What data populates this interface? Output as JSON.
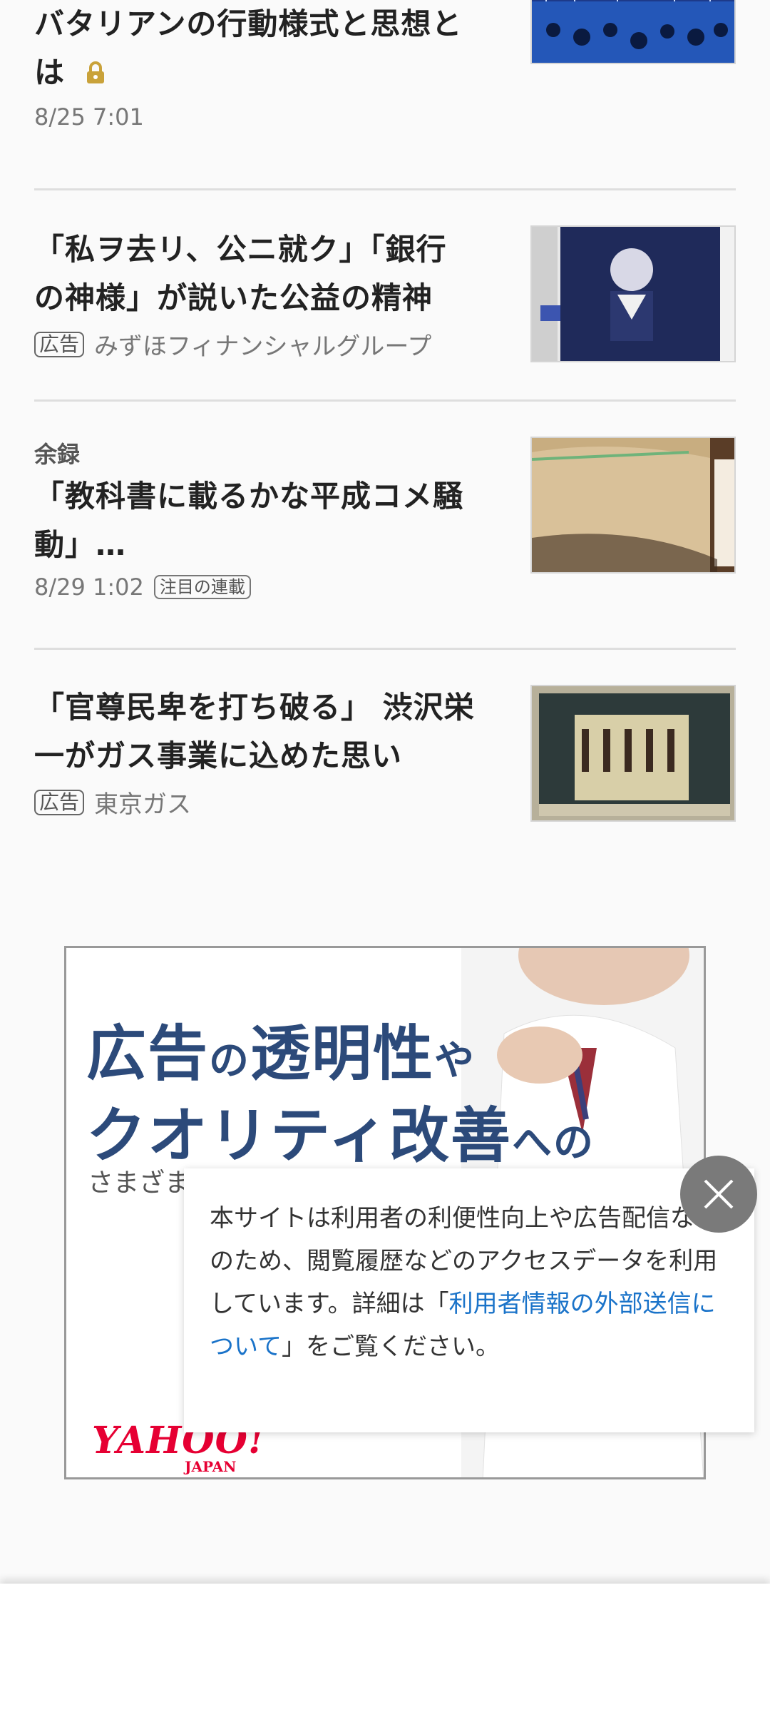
{
  "articles": [
    {
      "title_lines": [
        "バタリアンの行動様式と思想と",
        "は"
      ],
      "date": "8/25 7:01",
      "locked": true,
      "icon": "lock-icon"
    },
    {
      "title_lines": [
        "「私ヲ去リ、公ニ就ク」「銀行",
        "の神様」が説いた公益の精神"
      ],
      "ad_badge": "広告",
      "sponsor": "みずほフィナンシャルグループ"
    },
    {
      "section": "余録",
      "title_lines": [
        "「教科書に載るかな平成コメ騒",
        "動」…"
      ],
      "date": "8/29 1:02",
      "badge": "注目の連載"
    },
    {
      "title_lines": [
        "「官尊民卑を打ち破る」 渋沢栄",
        "一がガス事業に込めた思い"
      ],
      "ad_badge": "広告",
      "sponsor": "東京ガス"
    }
  ],
  "banner": {
    "line1_a": "広告",
    "line1_b": "の",
    "line1_c": "透明性",
    "line1_d": "や",
    "line2_a": "クオリティ改善",
    "line2_b": "への",
    "sub": "さまざまな取り組みを進めています",
    "logo": "YAHOO!",
    "logo_sub": "JAPAN"
  },
  "notice": {
    "text_before": "本サイトは利用者の利便性向上や広告配信などのため、閲覧履歴などのアクセスデータを利用しています。詳細は「",
    "link": "利用者情報の外部送信について",
    "text_after": "」をご覧ください。",
    "close_icon": "close-icon"
  },
  "colors": {
    "link": "#1a73c9",
    "banner_headline": "#2c4a7a",
    "yahoo_red": "#e60033",
    "lock": "#c9a23a"
  }
}
